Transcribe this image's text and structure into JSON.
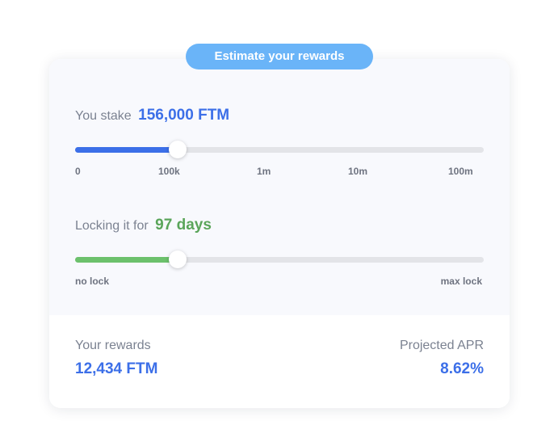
{
  "header": {
    "pill_label": "Estimate your rewards"
  },
  "stake": {
    "label": "You stake",
    "value": "156,000 FTM",
    "fraction": 0.25,
    "fill_color": "#3c6fe8",
    "ticks": [
      "0",
      "100k",
      "1m",
      "10m",
      "100m"
    ]
  },
  "lock": {
    "label": "Locking it for",
    "value": "97 days",
    "fraction": 0.25,
    "fill_color": "#6cc16c",
    "min_label": "no lock",
    "max_label": "max lock"
  },
  "results": {
    "rewards_label": "Your rewards",
    "rewards_value": "12,434 FTM",
    "apr_label": "Projected APR",
    "apr_value": "8.62%"
  },
  "colors": {
    "accent_blue": "#3c6fe8",
    "accent_green": "#5aa55a",
    "pill": "#6ab4f8"
  }
}
